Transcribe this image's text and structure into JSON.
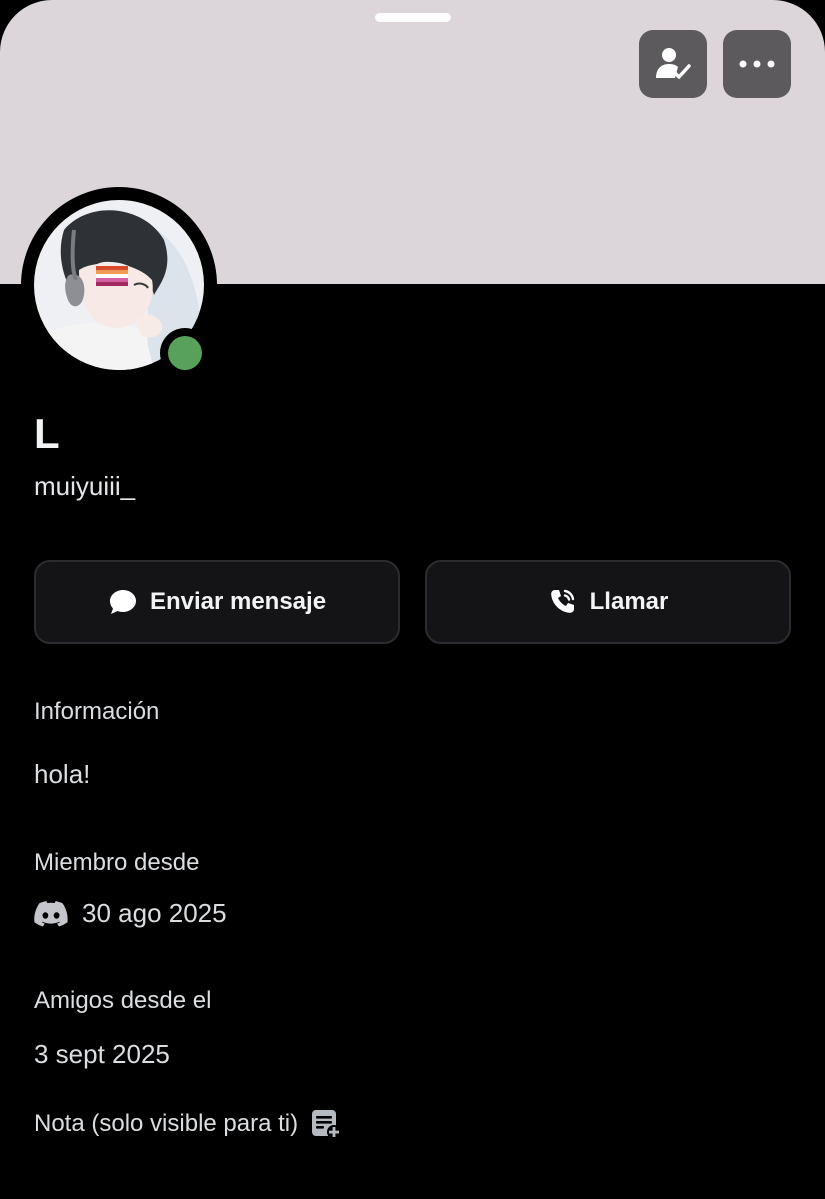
{
  "header": {
    "friend_button_icon": "person-check-icon",
    "more_button_icon": "more-dots-icon",
    "banner_color": "#dcd5da"
  },
  "profile": {
    "display_name": "L",
    "username": "muiyuiii_",
    "status": "online",
    "status_color": "#58a15b"
  },
  "actions": {
    "message_label": "Enviar mensaje",
    "message_icon": "chat-bubble-icon",
    "call_label": "Llamar",
    "call_icon": "phone-call-icon"
  },
  "info": {
    "heading": "Información",
    "bio": "hola!"
  },
  "member_since": {
    "heading": "Miembro desde",
    "date": "30 ago 2025",
    "icon": "discord-icon"
  },
  "friends_since": {
    "heading": "Amigos desde el",
    "date": "3 sept 2025"
  },
  "note": {
    "label": "Nota (solo visible para ti)",
    "icon": "add-note-icon"
  }
}
